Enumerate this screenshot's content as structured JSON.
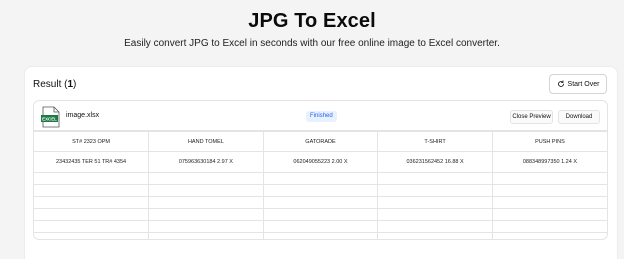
{
  "page": {
    "title": "JPG To Excel",
    "subtitle": "Easily convert JPG to Excel in seconds with our free online image to Excel converter."
  },
  "result": {
    "label": "Result",
    "count": "1",
    "start_over_label": "Start Over"
  },
  "file": {
    "icon_label": "EXCEL",
    "name": "image.xlsx",
    "status": "Finished",
    "close_preview_label": "Close Preview",
    "download_label": "Download"
  },
  "table": {
    "headers": [
      "ST# 2323 OPM",
      "HAND TOMEL",
      "GATORADE",
      "T-SHIRT",
      "PUSH PINS"
    ],
    "rows": [
      [
        "23432435 TER 51 TR# 4354",
        "075963630184 2.97 X",
        "062049055223 2.00 X",
        "036231562452 16.88 X",
        "088348997350 1.24 X"
      ],
      [
        "",
        "",
        "",
        "",
        ""
      ],
      [
        "",
        "",
        "",
        "",
        ""
      ],
      [
        "",
        "",
        "",
        "",
        ""
      ],
      [
        "",
        "",
        "",
        "",
        ""
      ],
      [
        "",
        "",
        "",
        "",
        ""
      ],
      [
        "",
        "",
        "",
        "",
        ""
      ]
    ]
  },
  "colors": {
    "accent": "#2563eb",
    "excel_green": "#1d7a45",
    "background": "#f4f4f5"
  }
}
